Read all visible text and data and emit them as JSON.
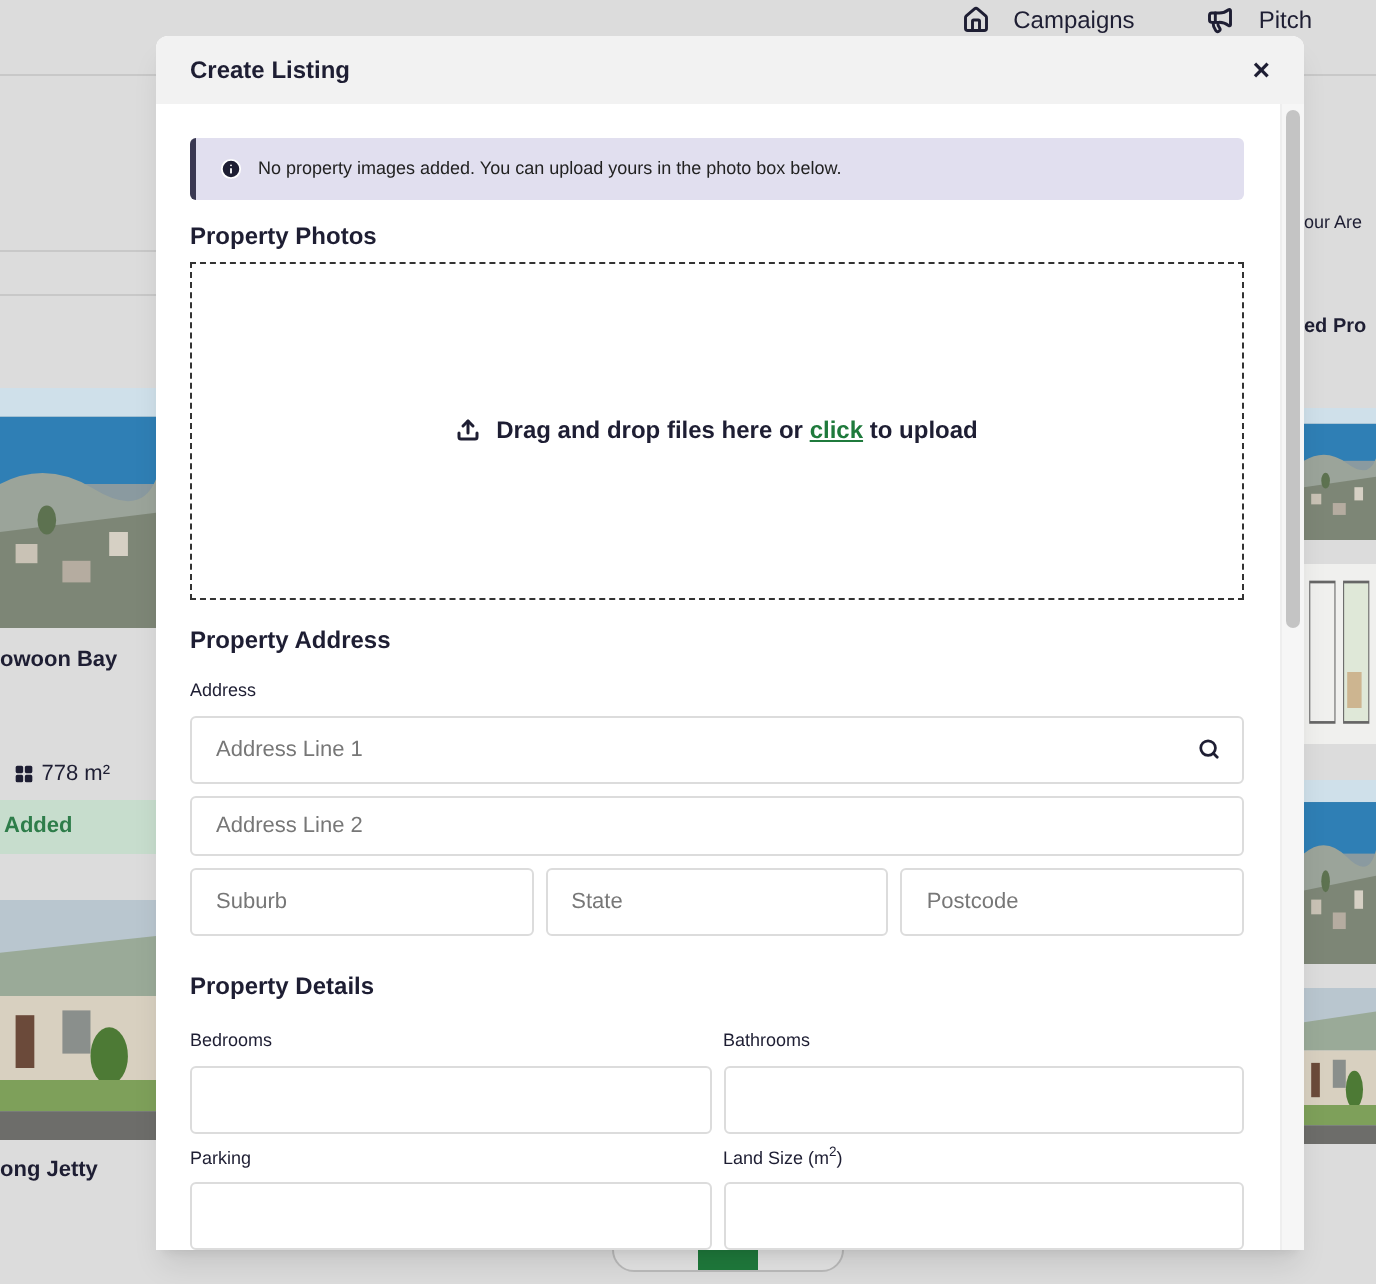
{
  "background": {
    "nav": [
      {
        "label": "Campaigns"
      },
      {
        "label": "Pitch"
      }
    ],
    "left_cards": [
      {
        "title": "owoon Bay",
        "area": "778 m²",
        "status": "Added"
      },
      {
        "title": "ong Jetty"
      }
    ],
    "right_texts": [
      "our Are",
      "ed Pro"
    ]
  },
  "modal": {
    "title": "Create Listing",
    "close": "×",
    "notice": "No property images added. You can upload yours in the photo box below.",
    "photos": {
      "heading": "Property Photos",
      "prompt_before": "Drag and drop files here or",
      "link": "click",
      "prompt_after": "to upload"
    },
    "address": {
      "heading": "Property Address",
      "label": "Address",
      "line1": {
        "placeholder": "Address Line 1"
      },
      "line2": {
        "placeholder": "Address Line 2"
      },
      "row": [
        {
          "placeholder": "Suburb"
        },
        {
          "placeholder": "State"
        },
        {
          "placeholder": "Postcode"
        }
      ]
    },
    "details": {
      "heading": "Property Details",
      "fields": [
        {
          "label": "Bedrooms"
        },
        {
          "label": "Bathrooms"
        },
        {
          "label": "Parking"
        },
        {
          "label": "Land Size (m$^{2}$)"
        }
      ]
    }
  }
}
